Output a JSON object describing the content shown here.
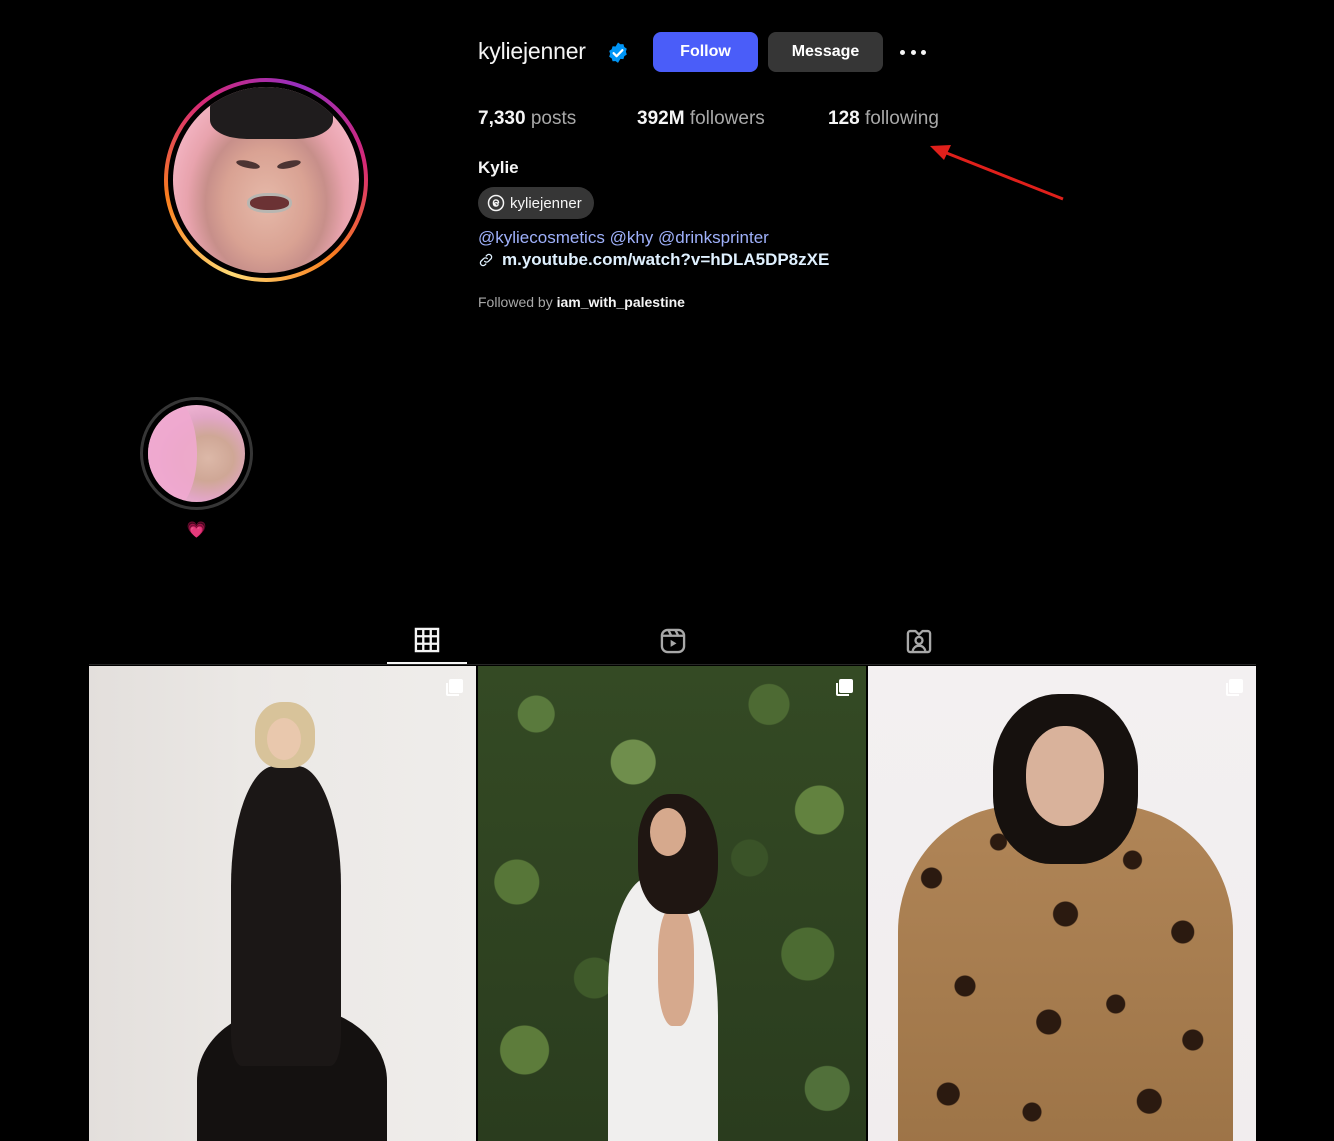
{
  "profile": {
    "username": "kyliejenner",
    "verified": true,
    "full_name": "Kylie",
    "threads_handle": "kyliejenner",
    "bio_mentions": [
      "@kyliecosmetics",
      "@khy",
      "@drinksprinter"
    ],
    "link": "m.youtube.com/watch?v=hDLA5DP8zXE",
    "followed_by_label": "Followed by",
    "followed_by_user": "iam_with_palestine"
  },
  "actions": {
    "follow_label": "Follow",
    "message_label": "Message",
    "more_icon": "more-horizontal-icon"
  },
  "stats": {
    "posts_count": "7,330",
    "posts_label": "posts",
    "followers_count": "392M",
    "followers_label": "followers",
    "following_count": "128",
    "following_label": "following"
  },
  "highlights": [
    {
      "label": "💗"
    }
  ],
  "tabs": [
    {
      "icon": "grid-icon",
      "active": true
    },
    {
      "icon": "reels-icon",
      "active": false
    },
    {
      "icon": "tagged-icon",
      "active": false
    }
  ],
  "posts": [
    {
      "type": "carousel",
      "icon": "multiple-posts-icon"
    },
    {
      "type": "carousel",
      "icon": "multiple-posts-icon"
    },
    {
      "type": "carousel",
      "icon": "multiple-posts-icon"
    }
  ],
  "colors": {
    "background": "#000000",
    "follow_button": "#4a5df9",
    "message_button": "#363636",
    "link_blue": "#9fb1fb",
    "verified_blue": "#0095f6",
    "annotation_arrow": "#e0201b"
  }
}
